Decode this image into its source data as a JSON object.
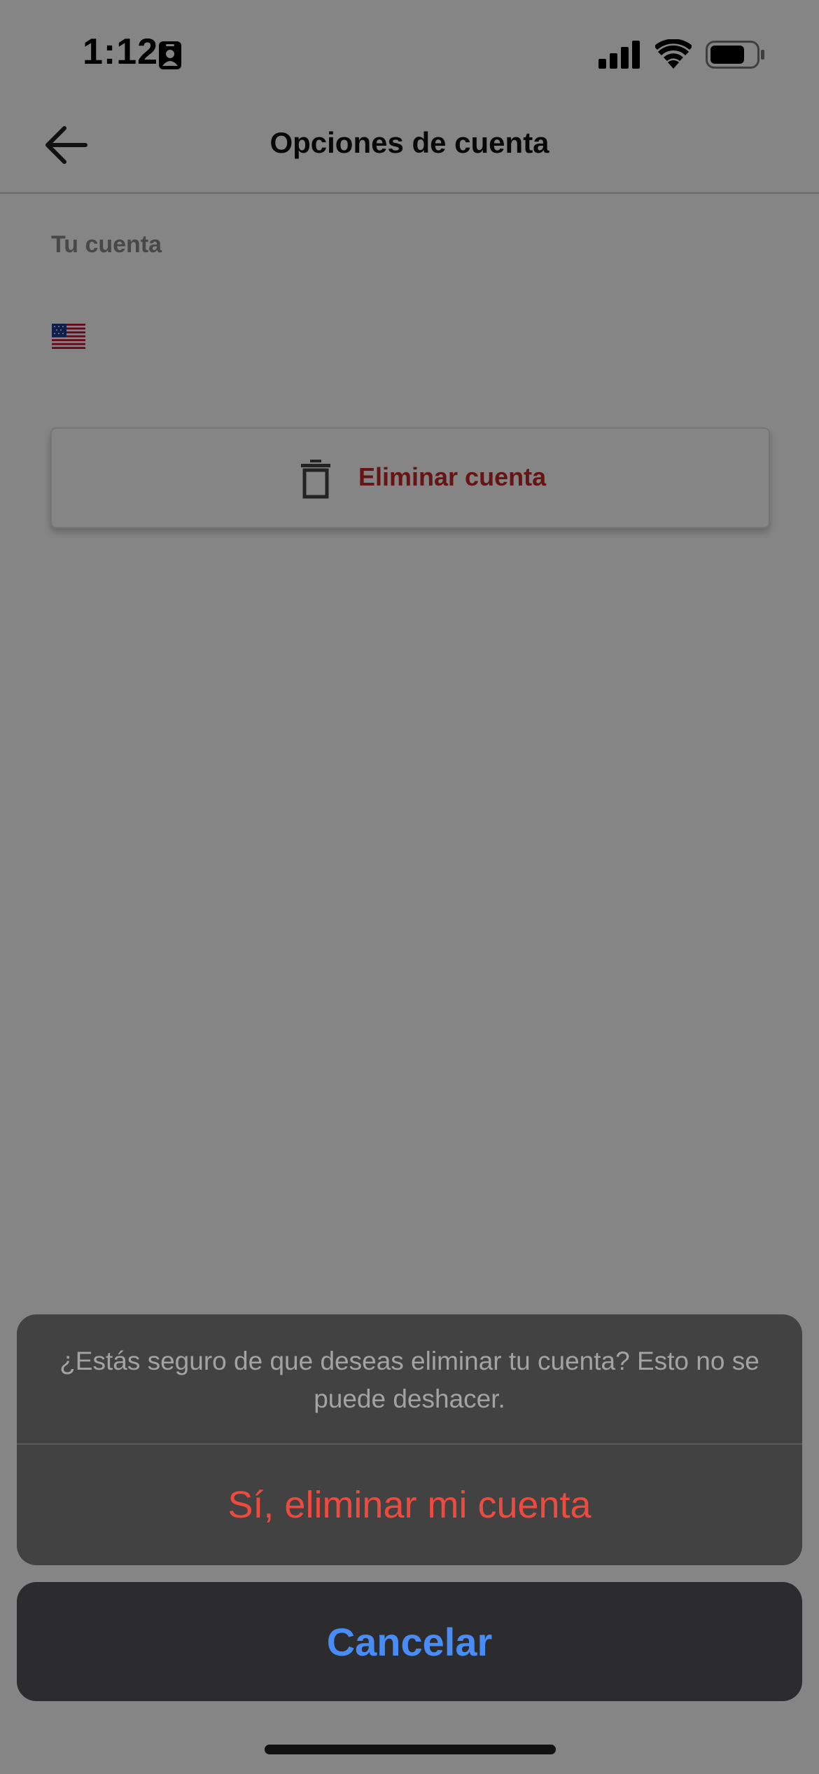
{
  "status_bar": {
    "time": "1:12",
    "icons": [
      "id-card-icon",
      "cellular-signal-icon",
      "wifi-icon",
      "battery-icon"
    ]
  },
  "header": {
    "title": "Opciones de cuenta",
    "back_icon": "arrow-left-icon"
  },
  "account": {
    "section_label": "Tu cuenta",
    "flag_icon": "us-flag-icon"
  },
  "delete_card": {
    "icon": "trash-icon",
    "label": "Eliminar cuenta",
    "color": "#c62828"
  },
  "action_sheet": {
    "message": "¿Estás seguro de que deseas eliminar tu cuenta? Esto no se puede deshacer.",
    "destructive_label": "Sí, eliminar mi cuenta",
    "destructive_color": "#ef4a3d",
    "cancel_label": "Cancelar",
    "cancel_color": "#4a8cf5"
  }
}
